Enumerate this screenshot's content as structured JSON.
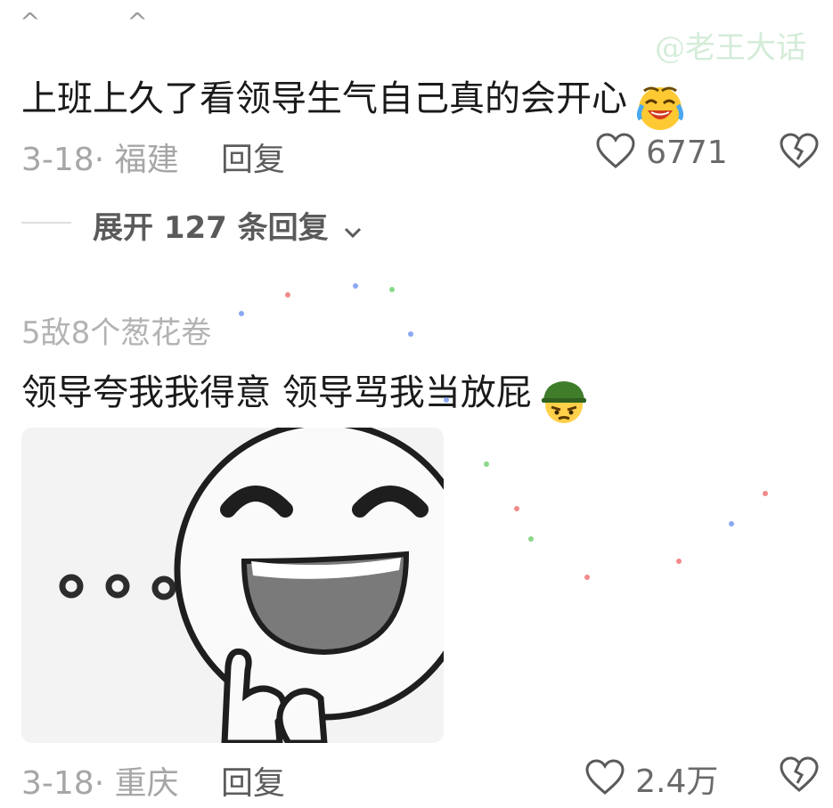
{
  "top_carets": "^ ^",
  "watermark": "@老王大话",
  "comment1": {
    "text": "上班上久了看领导生气自己真的会开心",
    "emoji": "laughing-crying-emoji",
    "date_location": "3-18· 福建",
    "reply_label": "回复",
    "likes": "6771"
  },
  "expand_replies": {
    "label": "展开 127 条回复",
    "icon": "chevron-down-icon"
  },
  "comment2": {
    "username": "5敌8个葱花卷",
    "text": "领导夸我我得意 领导骂我当放屁",
    "emoji": "soldier-angry-emoji",
    "sticker": "grinning-cartoon-face-sticker",
    "date_location": "3-18· 重庆",
    "reply_label": "回复",
    "likes": "2.4万"
  },
  "colors": {
    "text_primary": "#1a1a1a",
    "text_secondary": "#a6a6a6",
    "watermark": "#d4ecd8"
  }
}
